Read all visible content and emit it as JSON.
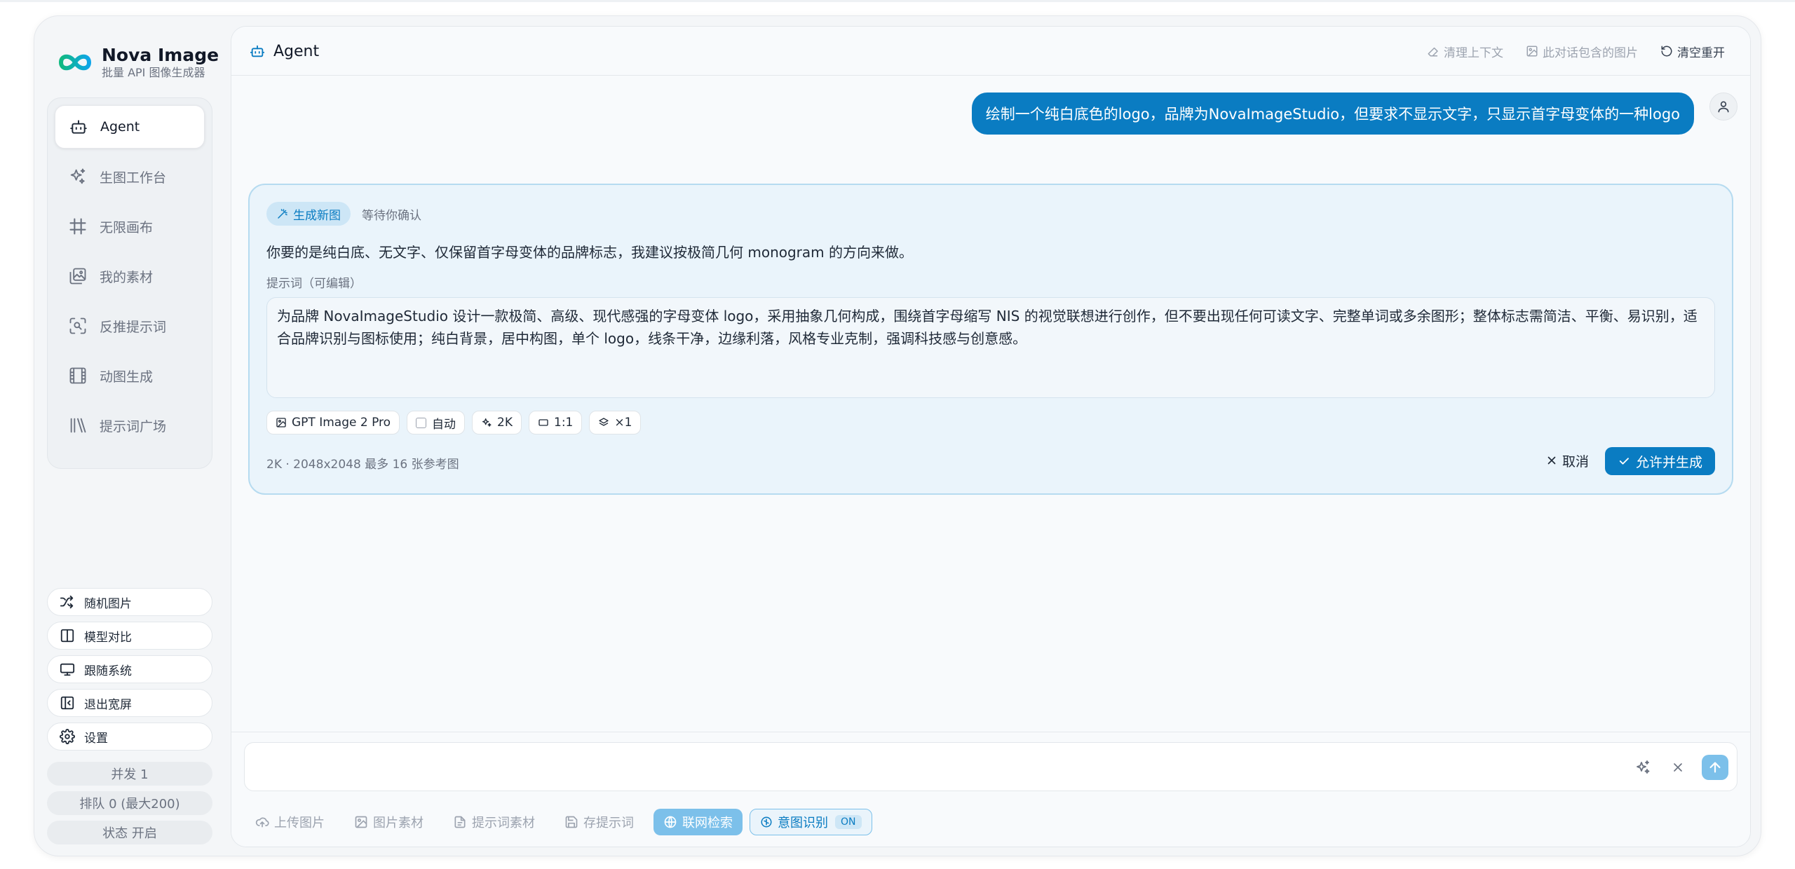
{
  "brand": {
    "name": "Nova Image",
    "subtitle": "批量 API 图像生成器",
    "accent": "#0a7cc2"
  },
  "sidebar": {
    "nav": [
      {
        "label": "Agent",
        "icon": "robot-icon",
        "active": true
      },
      {
        "label": "生图工作台",
        "icon": "sparkles-icon",
        "active": false
      },
      {
        "label": "无限画布",
        "icon": "grid-hash-icon",
        "active": false
      },
      {
        "label": "我的素材",
        "icon": "image-gallery-icon",
        "active": false
      },
      {
        "label": "反推提示词",
        "icon": "scan-image-icon",
        "active": false
      },
      {
        "label": "动图生成",
        "icon": "film-icon",
        "active": false
      },
      {
        "label": "提示词广场",
        "icon": "library-icon",
        "active": false
      }
    ],
    "bottom_buttons": [
      {
        "label": "随机图片",
        "icon": "shuffle-icon"
      },
      {
        "label": "模型对比",
        "icon": "columns-icon"
      },
      {
        "label": "跟随系统",
        "icon": "monitor-icon"
      },
      {
        "label": "退出宽屏",
        "icon": "collapse-panel-icon"
      },
      {
        "label": "设置",
        "icon": "gear-icon"
      }
    ],
    "stats": {
      "concurrency": "并发 1",
      "queue": "排队 0 (最大200)",
      "status": "状态 开启"
    }
  },
  "header": {
    "title": "Agent",
    "clear_context": "清理上下文",
    "conversation_images": "此对话包含的图片",
    "clear_restart": "清空重开"
  },
  "chat": {
    "user_message": "绘制一个纯白底色的logo，品牌为NovaImageStudio，但要求不显示文字，只显示首字母变体的一种logo"
  },
  "card": {
    "tag": "生成新图",
    "status": "等待你确认",
    "description": "你要的是纯白底、无文字、仅保留首字母变体的品牌标志，我建议按极简几何 monogram 的方向来做。",
    "prompt_label": "提示词（可编辑）",
    "prompt": "为品牌 NovaImageStudio 设计一款极简、高级、现代感强的字母变体 logo，采用抽象几何构成，围绕首字母缩写 NIS 的视觉联想进行创作，但不要出现任何可读文字、完整单词或多余图形；整体标志需简洁、平衡、易识别，适合品牌识别与图标使用；纯白背景，居中构图，单个 logo，线条干净，边缘利落，风格专业克制，强调科技感与创意感。",
    "options": {
      "model": "GPT Image 2 Pro",
      "auto": "自动",
      "resolution": "2K",
      "ratio": "1:1",
      "count": "×1"
    },
    "info": "2K · 2048x2048   最多 16 张参考图",
    "cancel": "取消",
    "confirm": "允许并生成"
  },
  "composer": {
    "placeholder": "",
    "tools": {
      "upload": "上传图片",
      "image_assets": "图片素材",
      "prompt_assets": "提示词素材",
      "save_prompt": "存提示词",
      "web_search": "联网检索",
      "intent": "意图识别",
      "intent_state": "ON"
    }
  }
}
